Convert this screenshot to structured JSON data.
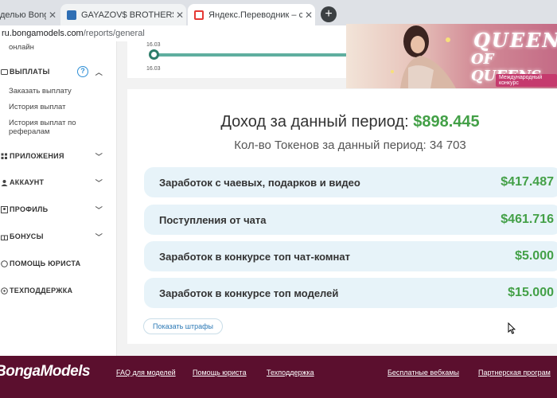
{
  "browser": {
    "tabs": [
      {
        "title": "делью BongaC",
        "active": false
      },
      {
        "title": "GAYAZOV$ BROTHER$ - По",
        "active": false
      },
      {
        "title": "Яндекс.Переводник – словарь",
        "active": true
      }
    ],
    "address": {
      "host": "ru.bongamodels.com",
      "path": "/reports/general"
    }
  },
  "sidebar": {
    "partial_item": "онлайн",
    "payouts": {
      "title": "ВЫПЛАТЫ",
      "help": "?",
      "items": [
        "Заказать выплату",
        "История выплат",
        "История выплат по рефералам"
      ]
    },
    "sections": [
      {
        "title": "ПРИЛОЖЕНИЯ"
      },
      {
        "title": "АККАУНТ"
      },
      {
        "title": "ПРОФИЛЬ"
      },
      {
        "title": "БОНУСЫ"
      },
      {
        "title": "ПОМОЩЬ ЮРИСТА"
      },
      {
        "title": "ТЕХПОДДЕРЖКА"
      }
    ]
  },
  "timeline": {
    "date_top": "16.03",
    "date_bottom": "16.03"
  },
  "report": {
    "income_label": "Доход за данный период:",
    "income_value": "$898.445",
    "tokens_text": "Кол-во Токенов за данный период: 34 703",
    "rows": [
      {
        "label": "Заработок с чаевых, подарков и видео",
        "value": "$417.487"
      },
      {
        "label": "Поступления от чата",
        "value": "$461.716"
      },
      {
        "label": "Заработок в конкурсе топ чат-комнат",
        "value": "$5.000"
      },
      {
        "label": "Заработок в конкурсе топ моделей",
        "value": "$15.000"
      }
    ],
    "penalty_button": "Показать штрафы"
  },
  "ad": {
    "line1": "QUEEN",
    "line2": "OF QUEENS",
    "badge": "Международный конкурс"
  },
  "footer": {
    "logo": "BongaModels",
    "links": [
      "FAQ для моделей",
      "Помощь юриста",
      "Техподдержка",
      "Бесплатные вебкамы",
      "Партнерская програм"
    ]
  },
  "colors": {
    "accent_green": "#43a047",
    "footer_bg": "#5b0f2e",
    "row_bg": "#e7f3f9",
    "link_blue": "#2a78b5"
  }
}
